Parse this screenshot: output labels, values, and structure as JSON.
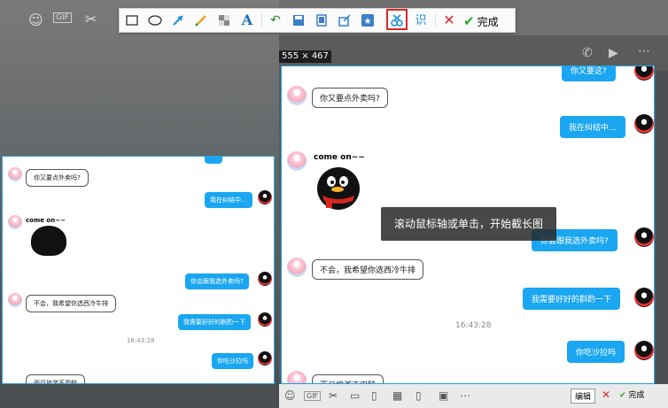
{
  "toolbar": {
    "recognize_label": "识",
    "done_label": "完成"
  },
  "size_label": "555 × 467",
  "tooltip": "滚动鼠标轴或单击，开始截长图",
  "capture_chat": {
    "top_bubble_fragment": "你又要这?",
    "msg1": "你又要点外卖吗?",
    "msg2": "我在纠结中...",
    "sticker_caption": "come on~~",
    "msg3": "你会跟我选外卖吗?",
    "msg4": "不会，我希望你选西冷牛排",
    "msg5": "我需要好好的斟酌一下",
    "time": "16:43:28",
    "msg6": "你吃沙拉吗",
    "msg7": "而且旅游不用醉"
  },
  "small_chat": {
    "msg1": "你又要点外卖吗?",
    "msg2": "我在纠结中...",
    "sticker_caption": "come on~~",
    "msg3": "你会跟我选外卖吗?",
    "msg4": "不会，我希望你选西冷牛排",
    "msg5": "我需要好好的斟酌一下",
    "time": "16:43:28",
    "msg6": "你吃沙拉吗",
    "msg7": "而且旅游不用醉"
  },
  "bottom_bar": {
    "edit_label": "编辑",
    "done_label": "完成"
  },
  "colors": {
    "accent": "#1aa6f0",
    "highlight": "#d92a2a",
    "done_check": "#2aa52a"
  }
}
